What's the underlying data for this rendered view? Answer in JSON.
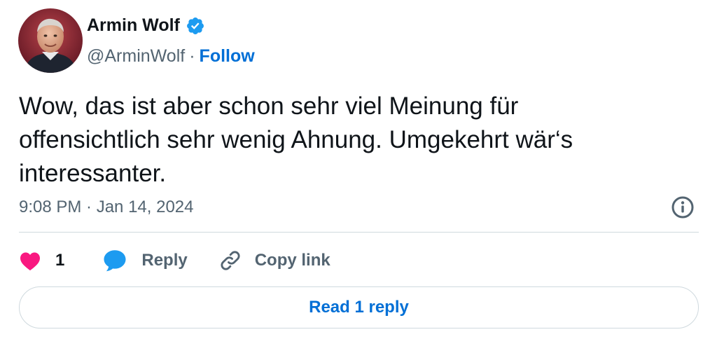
{
  "author": {
    "name": "Armin Wolf",
    "handle": "@ArminWolf",
    "separator": "·",
    "follow_label": "Follow",
    "verified_icon": "verified-badge-icon"
  },
  "tweet": {
    "text_lines": [
      "Wow, das ist aber schon sehr viel Meinung für",
      "offensichtlich sehr wenig Ahnung. Umgekehrt wär‘s",
      "interessanter."
    ],
    "timestamp": "9:08 PM · Jan 14, 2024"
  },
  "actions": {
    "like_count": "1",
    "reply_label": "Reply",
    "copy_link_label": "Copy link"
  },
  "read_replies_label": "Read 1 reply",
  "colors": {
    "brand_blue": "#006fd6",
    "verified_blue": "#1d9bf0",
    "like_pink": "#f91880",
    "reply_blue": "#1d9bf0",
    "text_primary": "#0f1419",
    "text_secondary": "#536471",
    "border": "#cfd9de"
  }
}
